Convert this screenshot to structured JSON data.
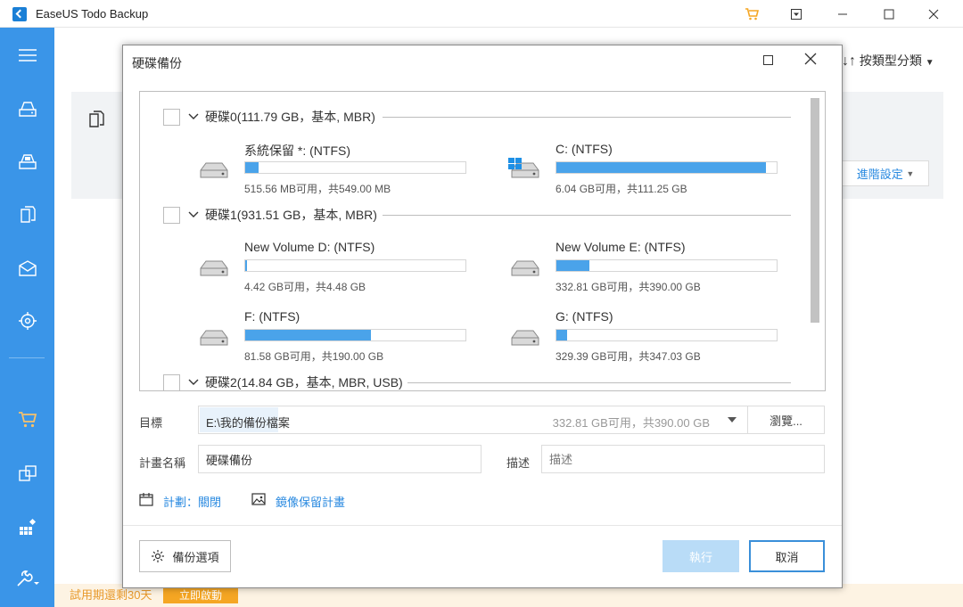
{
  "window": {
    "title": "EaseUS Todo Backup",
    "controls": [
      "cart-icon",
      "menu-icon",
      "minimize-icon",
      "maximize-icon",
      "close-icon"
    ]
  },
  "sidebar": {
    "items": [
      "menu-icon",
      "disk-backup-icon",
      "system-backup-icon",
      "file-backup-icon",
      "mail-backup-icon",
      "target-icon",
      "cart-icon",
      "clone-icon",
      "tools-icon",
      "settings-icon"
    ]
  },
  "background": {
    "sort_label": "按類型分類",
    "advanced_label": "進階設定",
    "trial_text": "試用期還剩30天",
    "trial_button": "立即啟動"
  },
  "dialog": {
    "title": "硬碟備份",
    "disks": [
      {
        "label": "硬碟0(111.79 GB，基本, MBR)",
        "partitions": [
          {
            "name": "系統保留 *: (NTFS)",
            "info": "515.56 MB可用，共549.00 MB",
            "used_fraction": 0.06,
            "windows": false
          },
          {
            "name": "C: (NTFS)",
            "info": "6.04 GB可用，共111.25 GB",
            "used_fraction": 0.95,
            "windows": true
          }
        ]
      },
      {
        "label": "硬碟1(931.51 GB，基本, MBR)",
        "partitions": [
          {
            "name": "New Volume D: (NTFS)",
            "info": "4.42 GB可用，共4.48 GB",
            "used_fraction": 0.01,
            "windows": false
          },
          {
            "name": "New Volume E: (NTFS)",
            "info": "332.81 GB可用，共390.00 GB",
            "used_fraction": 0.15,
            "windows": false
          },
          {
            "name": "F: (NTFS)",
            "info": "81.58 GB可用，共190.00 GB",
            "used_fraction": 0.57,
            "windows": false
          },
          {
            "name": "G: (NTFS)",
            "info": "329.39 GB可用，共347.03 GB",
            "used_fraction": 0.05,
            "windows": false
          }
        ]
      },
      {
        "label": "硬碟2(14.84 GB，基本, MBR, USB)",
        "partitions": []
      }
    ],
    "target_label": "目標",
    "target_path": "E:\\我的備份檔案",
    "target_size": "332.81 GB可用，共390.00 GB",
    "browse_label": "瀏覽...",
    "plan_name_label": "計畫名稱",
    "plan_name_value": "硬碟備份",
    "description_label": "描述",
    "description_placeholder": "描述",
    "schedule_link": "計劃：關閉",
    "image_reserve_link": "鏡像保留計畫",
    "options_button": "備份選項",
    "execute_button": "執行",
    "cancel_button": "取消"
  }
}
